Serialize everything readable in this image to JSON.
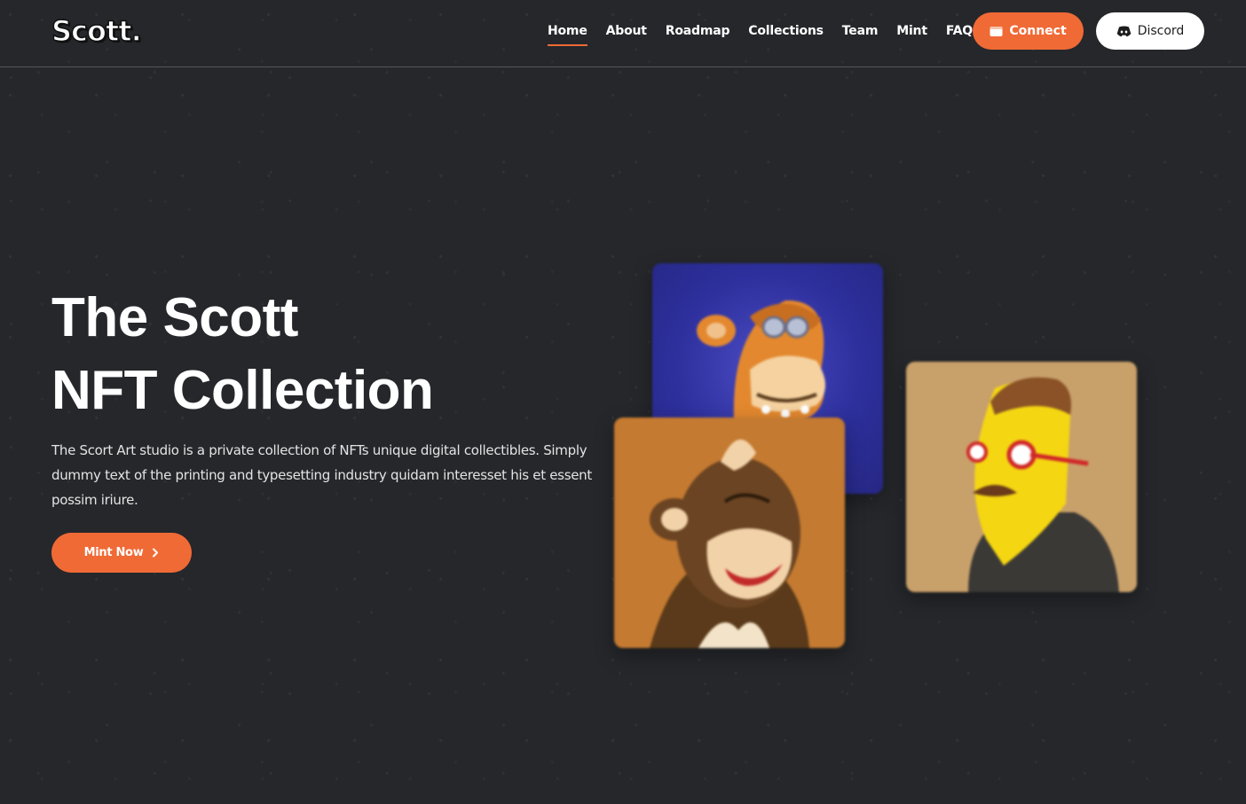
{
  "brand": {
    "logo_text": "Scott.",
    "accent_color": "#f06a36",
    "background_color": "#25272b"
  },
  "nav": {
    "items": [
      {
        "label": "Home",
        "active": true
      },
      {
        "label": "About",
        "active": false
      },
      {
        "label": "Roadmap",
        "active": false
      },
      {
        "label": "Collections",
        "active": false
      },
      {
        "label": "Team",
        "active": false
      },
      {
        "label": "Mint",
        "active": false
      },
      {
        "label": "FAQ",
        "active": false
      }
    ]
  },
  "header_buttons": {
    "connect_label": "Connect",
    "connect_icon": "wallet-icon",
    "discord_label": "Discord",
    "discord_icon": "discord-icon"
  },
  "hero": {
    "title_line1": "The Scott",
    "title_line2": "NFT Collection",
    "description": "The Scort Art studio is a private collection of NFTs unique digital collectibles. Simply dummy text of the printing and typesetting industry quidam interesset his et essent possim iriure.",
    "cta_label": "Mint Now",
    "cta_icon": "chevron-right-icon"
  },
  "gallery": {
    "cards": [
      {
        "subject": "orange ape with goggles",
        "background": "#2d2f9c"
      },
      {
        "subject": "brown monkey smiling",
        "background": "#c47a30"
      },
      {
        "subject": "yellow cartoon man with glasses",
        "background": "#c8a06a"
      }
    ]
  }
}
